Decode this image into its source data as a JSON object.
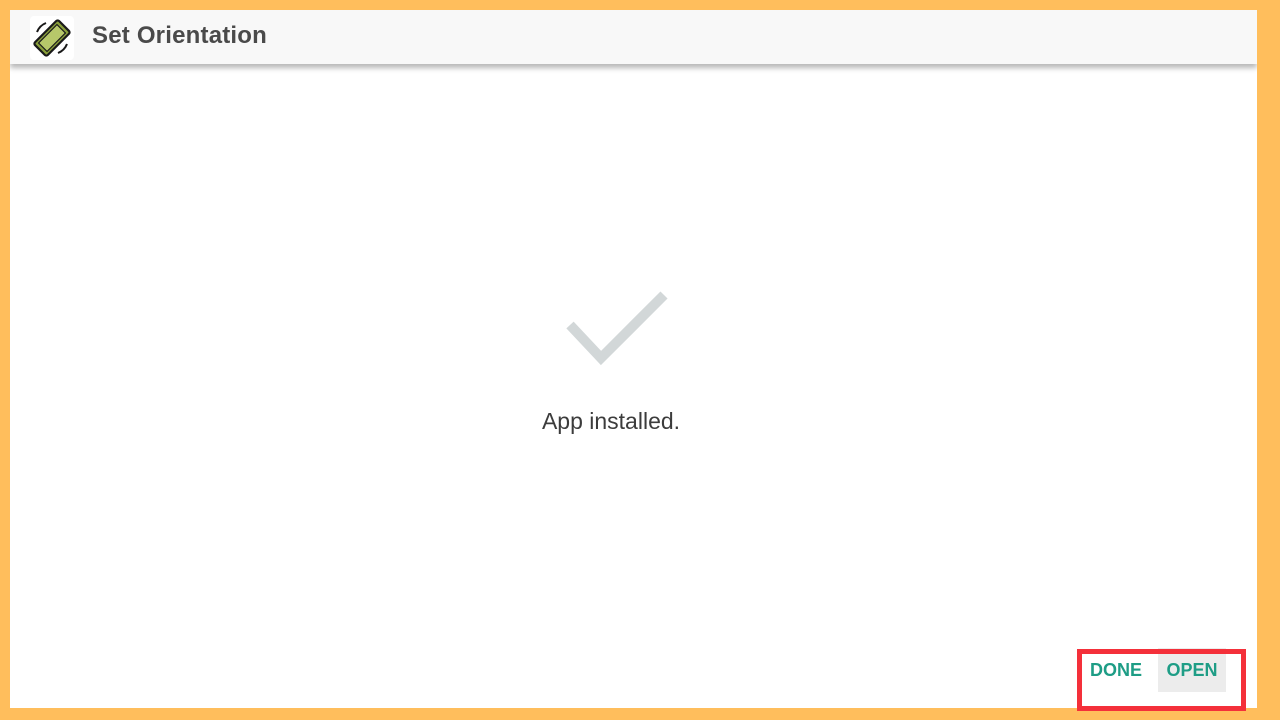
{
  "app_bar": {
    "icon": "screen-rotation-icon",
    "title": "Set Orientation"
  },
  "install": {
    "status_icon": "checkmark-icon",
    "status_text": "App installed."
  },
  "actions": {
    "done_label": "DONE",
    "open_label": "OPEN",
    "highlight": "open-done-highlight"
  },
  "colors": {
    "frame": "#FFBE5C",
    "app_bar": "#F8F8F8",
    "title_text": "#4A4A4A",
    "checkmark": "#D2D7D8",
    "button_text": "#1E9D86",
    "open_bg": "#ECECEC",
    "highlight_border": "#F4303A"
  }
}
